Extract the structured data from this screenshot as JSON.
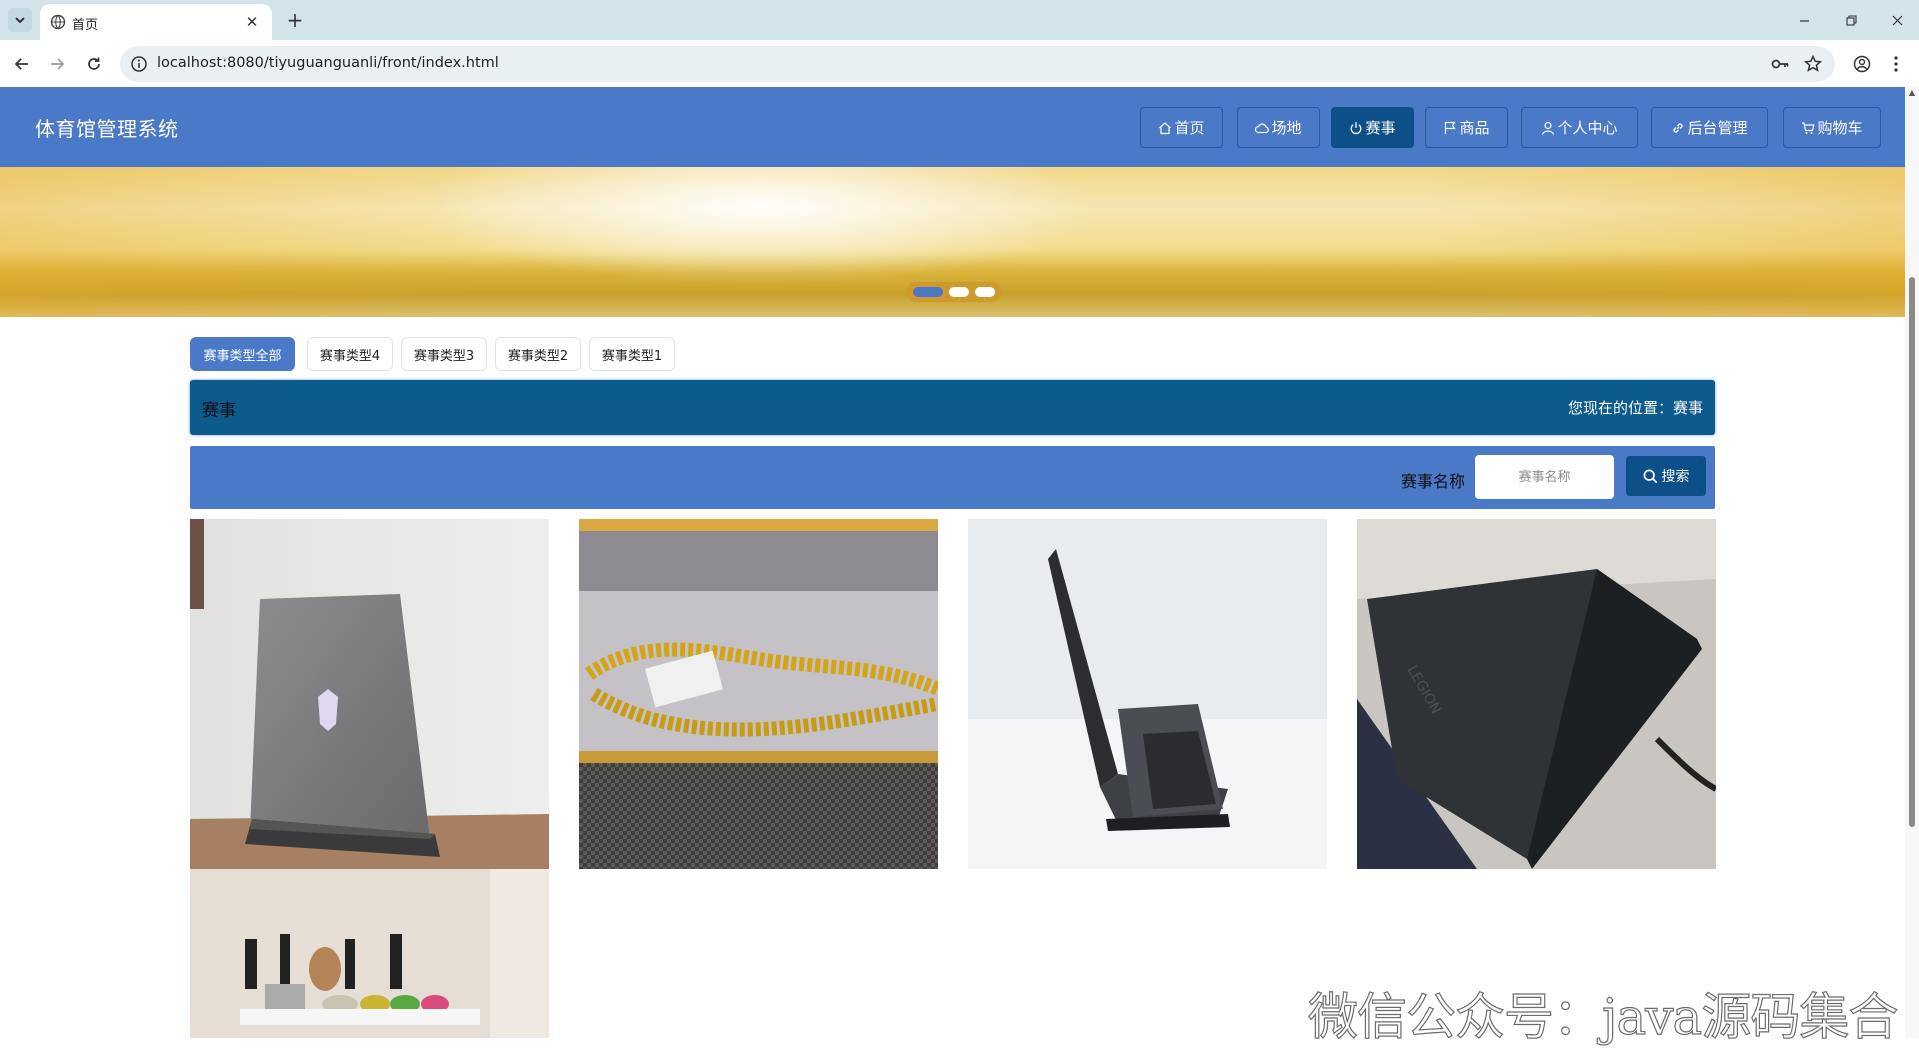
{
  "browser": {
    "tab_title": "首页",
    "url": "localhost:8080/tiyuguanguanli/front/index.html"
  },
  "site": {
    "title": "体育馆管理系统",
    "menu": [
      {
        "label": "首页",
        "icon": "home-icon",
        "active": false
      },
      {
        "label": "场地",
        "icon": "cloud-icon",
        "active": false
      },
      {
        "label": "赛事",
        "icon": "power-icon",
        "active": true
      },
      {
        "label": "商品",
        "icon": "flag-icon",
        "active": false
      },
      {
        "label": "个人中心",
        "icon": "user-icon",
        "active": false
      },
      {
        "label": "后台管理",
        "icon": "link-icon",
        "active": false
      },
      {
        "label": "购物车",
        "icon": "cart-icon",
        "active": false
      }
    ],
    "accent_color": "#4a79c8",
    "dark_color": "#0d4f88"
  },
  "banner": {
    "slides_count": 3,
    "active_slide": 1
  },
  "filters": [
    {
      "label": "赛事类型全部",
      "active": true
    },
    {
      "label": "赛事类型4",
      "active": false
    },
    {
      "label": "赛事类型3",
      "active": false
    },
    {
      "label": "赛事类型2",
      "active": false
    },
    {
      "label": "赛事类型1",
      "active": false
    }
  ],
  "breadcrumb": {
    "title": "赛事",
    "position_text": "您现在的位置：赛事"
  },
  "search": {
    "label": "赛事名称",
    "placeholder": "赛事名称",
    "value": "",
    "button_label": "搜索"
  },
  "cards": [
    {
      "image": "gray-gaming-laptop-back-view"
    },
    {
      "image": "gold-chain-necklace-in-box"
    },
    {
      "image": "black-laptop-side-view"
    },
    {
      "image": "dark-laptop-lid-closeup"
    },
    {
      "image": "kitchen-knife-rack-shelf"
    }
  ],
  "watermark": "微信公众号：java源码集合"
}
